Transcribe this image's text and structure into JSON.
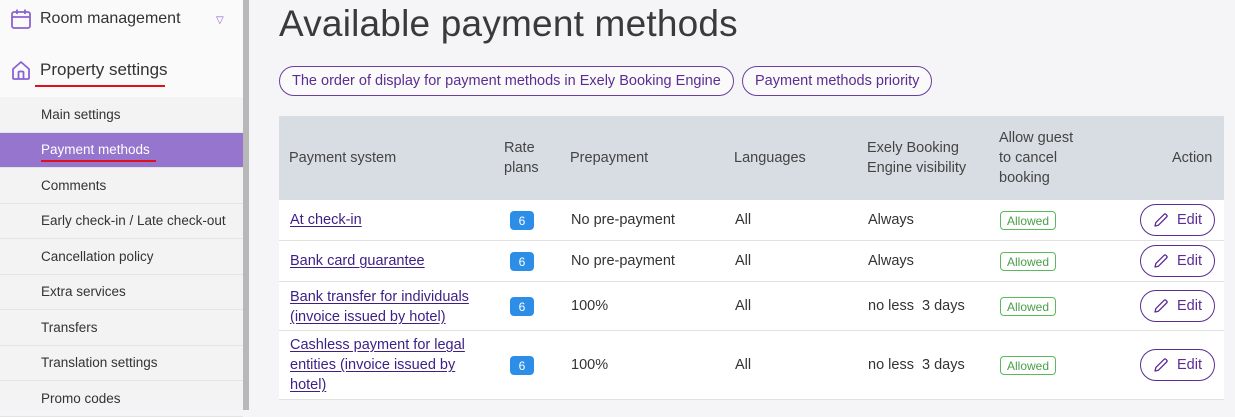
{
  "sidebar": {
    "sections": [
      {
        "label": "Room management",
        "icon": "calendar-icon"
      },
      {
        "label": "Property settings",
        "icon": "home-icon"
      }
    ],
    "items": [
      {
        "label": "Main settings",
        "active": false
      },
      {
        "label": "Payment methods",
        "active": true
      },
      {
        "label": "Comments",
        "active": false
      },
      {
        "label": "Early check-in / Late check-out",
        "active": false
      },
      {
        "label": "Cancellation policy",
        "active": false
      },
      {
        "label": "Extra services",
        "active": false
      },
      {
        "label": "Transfers",
        "active": false
      },
      {
        "label": "Translation settings",
        "active": false
      },
      {
        "label": "Promo codes",
        "active": false
      }
    ]
  },
  "main": {
    "title": "Available payment methods",
    "pills": [
      "The order of display for payment methods in Exely Booking Engine",
      "Payment methods priority"
    ],
    "table": {
      "headers": {
        "payment_system": "Payment system",
        "rate_plans": "Rate plans",
        "prepayment": "Prepayment",
        "languages": "Languages",
        "visibility": "Exely Booking Engine visibility",
        "cancel": "Allow guest to cancel booking",
        "action": "Action"
      },
      "rows": [
        {
          "payment_system": "At check-in",
          "rate_plans": "6",
          "prepayment": "No pre-payment",
          "languages": "All",
          "visibility": "Always",
          "cancel": "Allowed",
          "action": "Edit"
        },
        {
          "payment_system": "Bank card guarantee",
          "rate_plans": "6",
          "prepayment": "No pre-payment",
          "languages": "All",
          "visibility": "Always",
          "cancel": "Allowed",
          "action": "Edit"
        },
        {
          "payment_system": "Bank transfer for individuals (invoice issued by hotel)",
          "rate_plans": "6",
          "prepayment": "100%",
          "languages": "All",
          "visibility": "no less  3 days",
          "cancel": "Allowed",
          "action": "Edit"
        },
        {
          "payment_system": "Cashless payment for legal entities (invoice issued by hotel)",
          "rate_plans": "6",
          "prepayment": "100%",
          "languages": "All",
          "visibility": "no less  3 days",
          "cancel": "Allowed",
          "action": "Edit"
        }
      ]
    }
  },
  "colors": {
    "accent": "#5b2d93",
    "active_item": "#9575cd",
    "badge": "#2d8ee8",
    "allowed": "#5cb85c",
    "underline": "#e0101c"
  }
}
